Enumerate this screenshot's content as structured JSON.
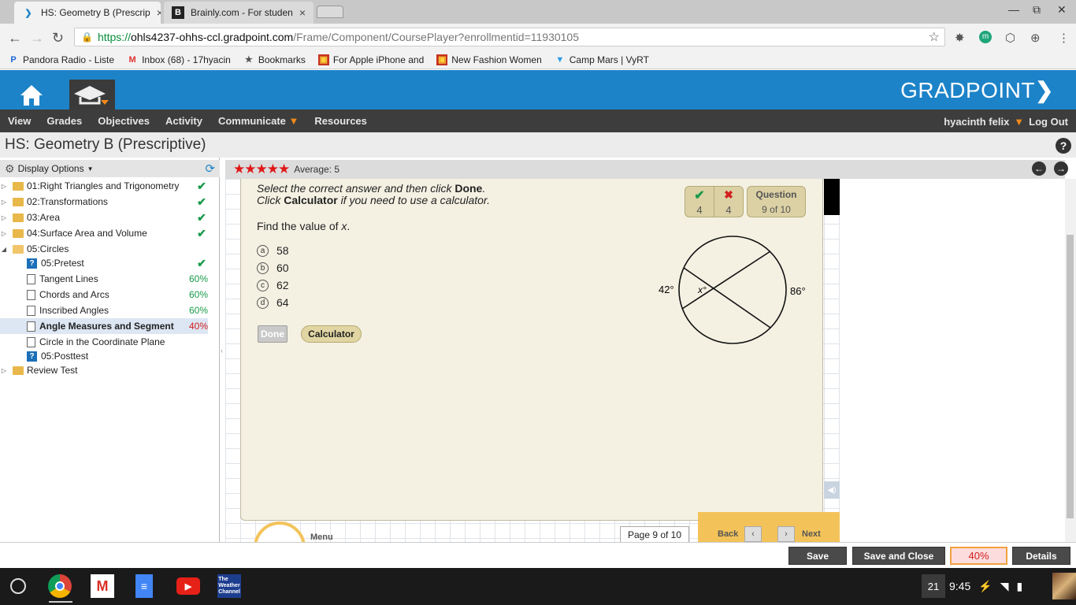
{
  "browser": {
    "tabs": [
      {
        "title": "HS: Geometry B (Prescrip",
        "active": true
      },
      {
        "title": "Brainly.com - For studen",
        "active": false
      }
    ],
    "url": {
      "scheme": "https://",
      "host": "ohls4237-ohhs-ccl.gradpoint.com",
      "path": "/Frame/Component/CoursePlayer?enrollmentid=11930105"
    },
    "bookmarks": [
      {
        "label": "Pandora Radio - Liste",
        "icon": "pandora-icon"
      },
      {
        "label": "Inbox (68) - 17hyacin",
        "icon": "gmail-icon"
      },
      {
        "label": "Bookmarks",
        "icon": "star-icon"
      },
      {
        "label": "For Apple iPhone and",
        "icon": "shopping-icon"
      },
      {
        "label": "New Fashion Women",
        "icon": "shopping-icon"
      },
      {
        "label": "Camp Mars | VyRT",
        "icon": "vyrt-icon"
      }
    ]
  },
  "app": {
    "logo": "GRADPOINT",
    "menu": [
      "View",
      "Grades",
      "Objectives",
      "Activity",
      "Communicate",
      "Resources"
    ],
    "user": "hyacinth felix",
    "logout": "Log Out",
    "course_title": "HS: Geometry B (Prescriptive)",
    "help": "?"
  },
  "sidebar": {
    "display_options": "Display Options",
    "items": [
      {
        "label": "01:Right Triangles and Trigonometry",
        "kind": "folder",
        "status": "✔",
        "level": 0
      },
      {
        "label": "02:Transformations",
        "kind": "folder",
        "status": "✔",
        "level": 0
      },
      {
        "label": "03:Area",
        "kind": "folder",
        "status": "✔",
        "level": 0
      },
      {
        "label": "04:Surface Area and Volume",
        "kind": "folder",
        "status": "✔",
        "level": 0
      },
      {
        "label": "05:Circles",
        "kind": "folder",
        "status": "",
        "level": 0
      },
      {
        "label": "05:Pretest",
        "kind": "quiz",
        "status": "✔",
        "level": 1
      },
      {
        "label": "Tangent Lines",
        "kind": "doc",
        "status": "60%",
        "level": 1
      },
      {
        "label": "Chords and Arcs",
        "kind": "doc",
        "status": "60%",
        "level": 1
      },
      {
        "label": "Inscribed Angles",
        "kind": "doc",
        "status": "60%",
        "level": 1
      },
      {
        "label": "Angle Measures and Segment",
        "kind": "doc",
        "status": "40%",
        "level": 1
      },
      {
        "label": "Circle in the Coordinate Plane",
        "kind": "doc",
        "status": "",
        "level": 1
      },
      {
        "label": "05:Posttest",
        "kind": "quiz",
        "status": "",
        "level": 1
      },
      {
        "label": "Review Test",
        "kind": "folder",
        "status": "",
        "level": 0
      }
    ]
  },
  "rating": {
    "stars": 5,
    "text": "Average: 5"
  },
  "question": {
    "instr_line1_pre": "Select the correct answer and then click ",
    "instr_line1_bold": "Done",
    "instr_line1_post": ".",
    "instr_line2_pre": "Click ",
    "instr_line2_bold": "Calculator",
    "instr_line2_post": " if you need to use a calculator.",
    "prompt_pre": "Find the value of ",
    "prompt_var": "x",
    "prompt_post": ".",
    "options": [
      {
        "letter": "a",
        "value": "58"
      },
      {
        "letter": "b",
        "value": "60"
      },
      {
        "letter": "c",
        "value": "62"
      },
      {
        "letter": "d",
        "value": "64"
      }
    ],
    "done_label": "Done",
    "calculator_label": "Calculator",
    "correct_count": "4",
    "incorrect_count": "4",
    "question_label": "Question",
    "question_progress": "9 of 10",
    "diagram": {
      "left_arc": "42°",
      "right_arc": "86°",
      "angle": "x°"
    }
  },
  "pager": {
    "page": "Page  9 of 10",
    "back": "Back",
    "next": "Next",
    "menu": "Menu"
  },
  "footer": {
    "save": "Save",
    "save_close": "Save and Close",
    "percent": "40%",
    "details": "Details"
  },
  "shelf": {
    "notification_count": "21",
    "time": "9:45",
    "weather_label": "The Weather Channel"
  }
}
